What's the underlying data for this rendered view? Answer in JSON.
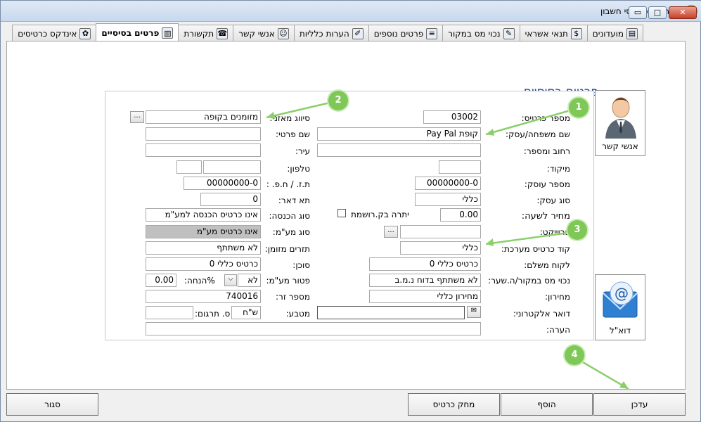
{
  "window": {
    "title": "ריווחית - כרטיסי חשבון"
  },
  "tabs": [
    {
      "label": "מועדונים",
      "icon": "chart-icon"
    },
    {
      "label": "תנאי אשראי",
      "icon": "money-bag-icon"
    },
    {
      "label": "נכוי מס במקור",
      "icon": "pen-icon"
    },
    {
      "label": "פרטים נוספים",
      "icon": "notepad-icon"
    },
    {
      "label": "הערות כלליות",
      "icon": "edit-icon"
    },
    {
      "label": "אנשי קשר",
      "icon": "contacts-icon"
    },
    {
      "label": "תקשורת",
      "icon": "phone-icon"
    },
    {
      "label": "פרטים בסיסיים",
      "icon": "book-icon"
    },
    {
      "label": "אינדקס כרטיסים",
      "icon": "dog-icon"
    }
  ],
  "section_title": "פרטים בסיסיים",
  "right_labels": {
    "card_number": "מספר כרטיס:",
    "family_name": "שם משפחה/עסק:",
    "street": "רחוב ומספר:",
    "zip": "מיקוד:",
    "business_number": "מספר עוסק:",
    "business_type": "סוג עסק:",
    "hourly_price": "מחיר לשעה:",
    "project": "פרוייקט:",
    "system_card_code": "קוד כרטיס מערכת:",
    "paying_customer": "לקוח משלם:",
    "withholding": "נכוי מס במקור/ה.שער:",
    "price_list": "מחירון:",
    "email": "דואר אלקטרוני:",
    "note": "הערה:"
  },
  "left_labels": {
    "balance_class": "סיווג מאזני:",
    "first_name": "שם פרטי:",
    "city": "עיר:",
    "phone": "טלפון:",
    "id_number": "ת.ז. / ח.פ. :",
    "po_box": "תא דאר:",
    "income_type": "סוג הכנסה:",
    "vat_type": "סוג מע\"מ:",
    "cash_flow": "תזרים מזומן:",
    "agent": "סוכן:",
    "vat_exempt": "פטור מע\"מ:",
    "discount": "%הנחה:",
    "foreign_number": "מספר זר:",
    "currency": "מטבע:",
    "translation": "ס. תרגום:"
  },
  "values": {
    "card_number": "03002",
    "family_name": "קופת Pay Pal",
    "street": "",
    "zip": "",
    "business_number": "00000000-0",
    "business_type": "כללי",
    "hourly_price": "0.00",
    "balance_due_label": "יתרה בק.רושמת",
    "project": "",
    "system_card_code": "כללי",
    "paying_customer": "כרטיס כללי 0",
    "withholding": "לא משתתף בדוח נ.מ.ב",
    "price_list": "מחירון כללי",
    "email": "",
    "note": "",
    "balance_class": "מזומנים בקופה",
    "first_name": "",
    "city": "",
    "phone_prefix": "",
    "phone": "",
    "id_number": "00000000-0",
    "po_box": "0",
    "income_type": "אינו כרטיס הכנסה למע\"מ",
    "vat_type": "אינו כרטיס מע\"מ",
    "cash_flow": "לא משתתף",
    "agent": "כרטיס כללי 0",
    "vat_exempt": "לא",
    "discount": "0.00",
    "foreign_number": "740016",
    "currency": "ש\"ח",
    "translation": ""
  },
  "side_buttons": {
    "contacts": "אנשי קשר",
    "email": "דוא\"ל"
  },
  "bottom_buttons": {
    "update": "עדכן",
    "add": "הוסף",
    "delete": "מחק כרטיס",
    "close": "סגור"
  },
  "badges": [
    "1",
    "2",
    "3",
    "4"
  ],
  "colors": {
    "badge": "#7fc857",
    "title": "#1f3d8f"
  }
}
